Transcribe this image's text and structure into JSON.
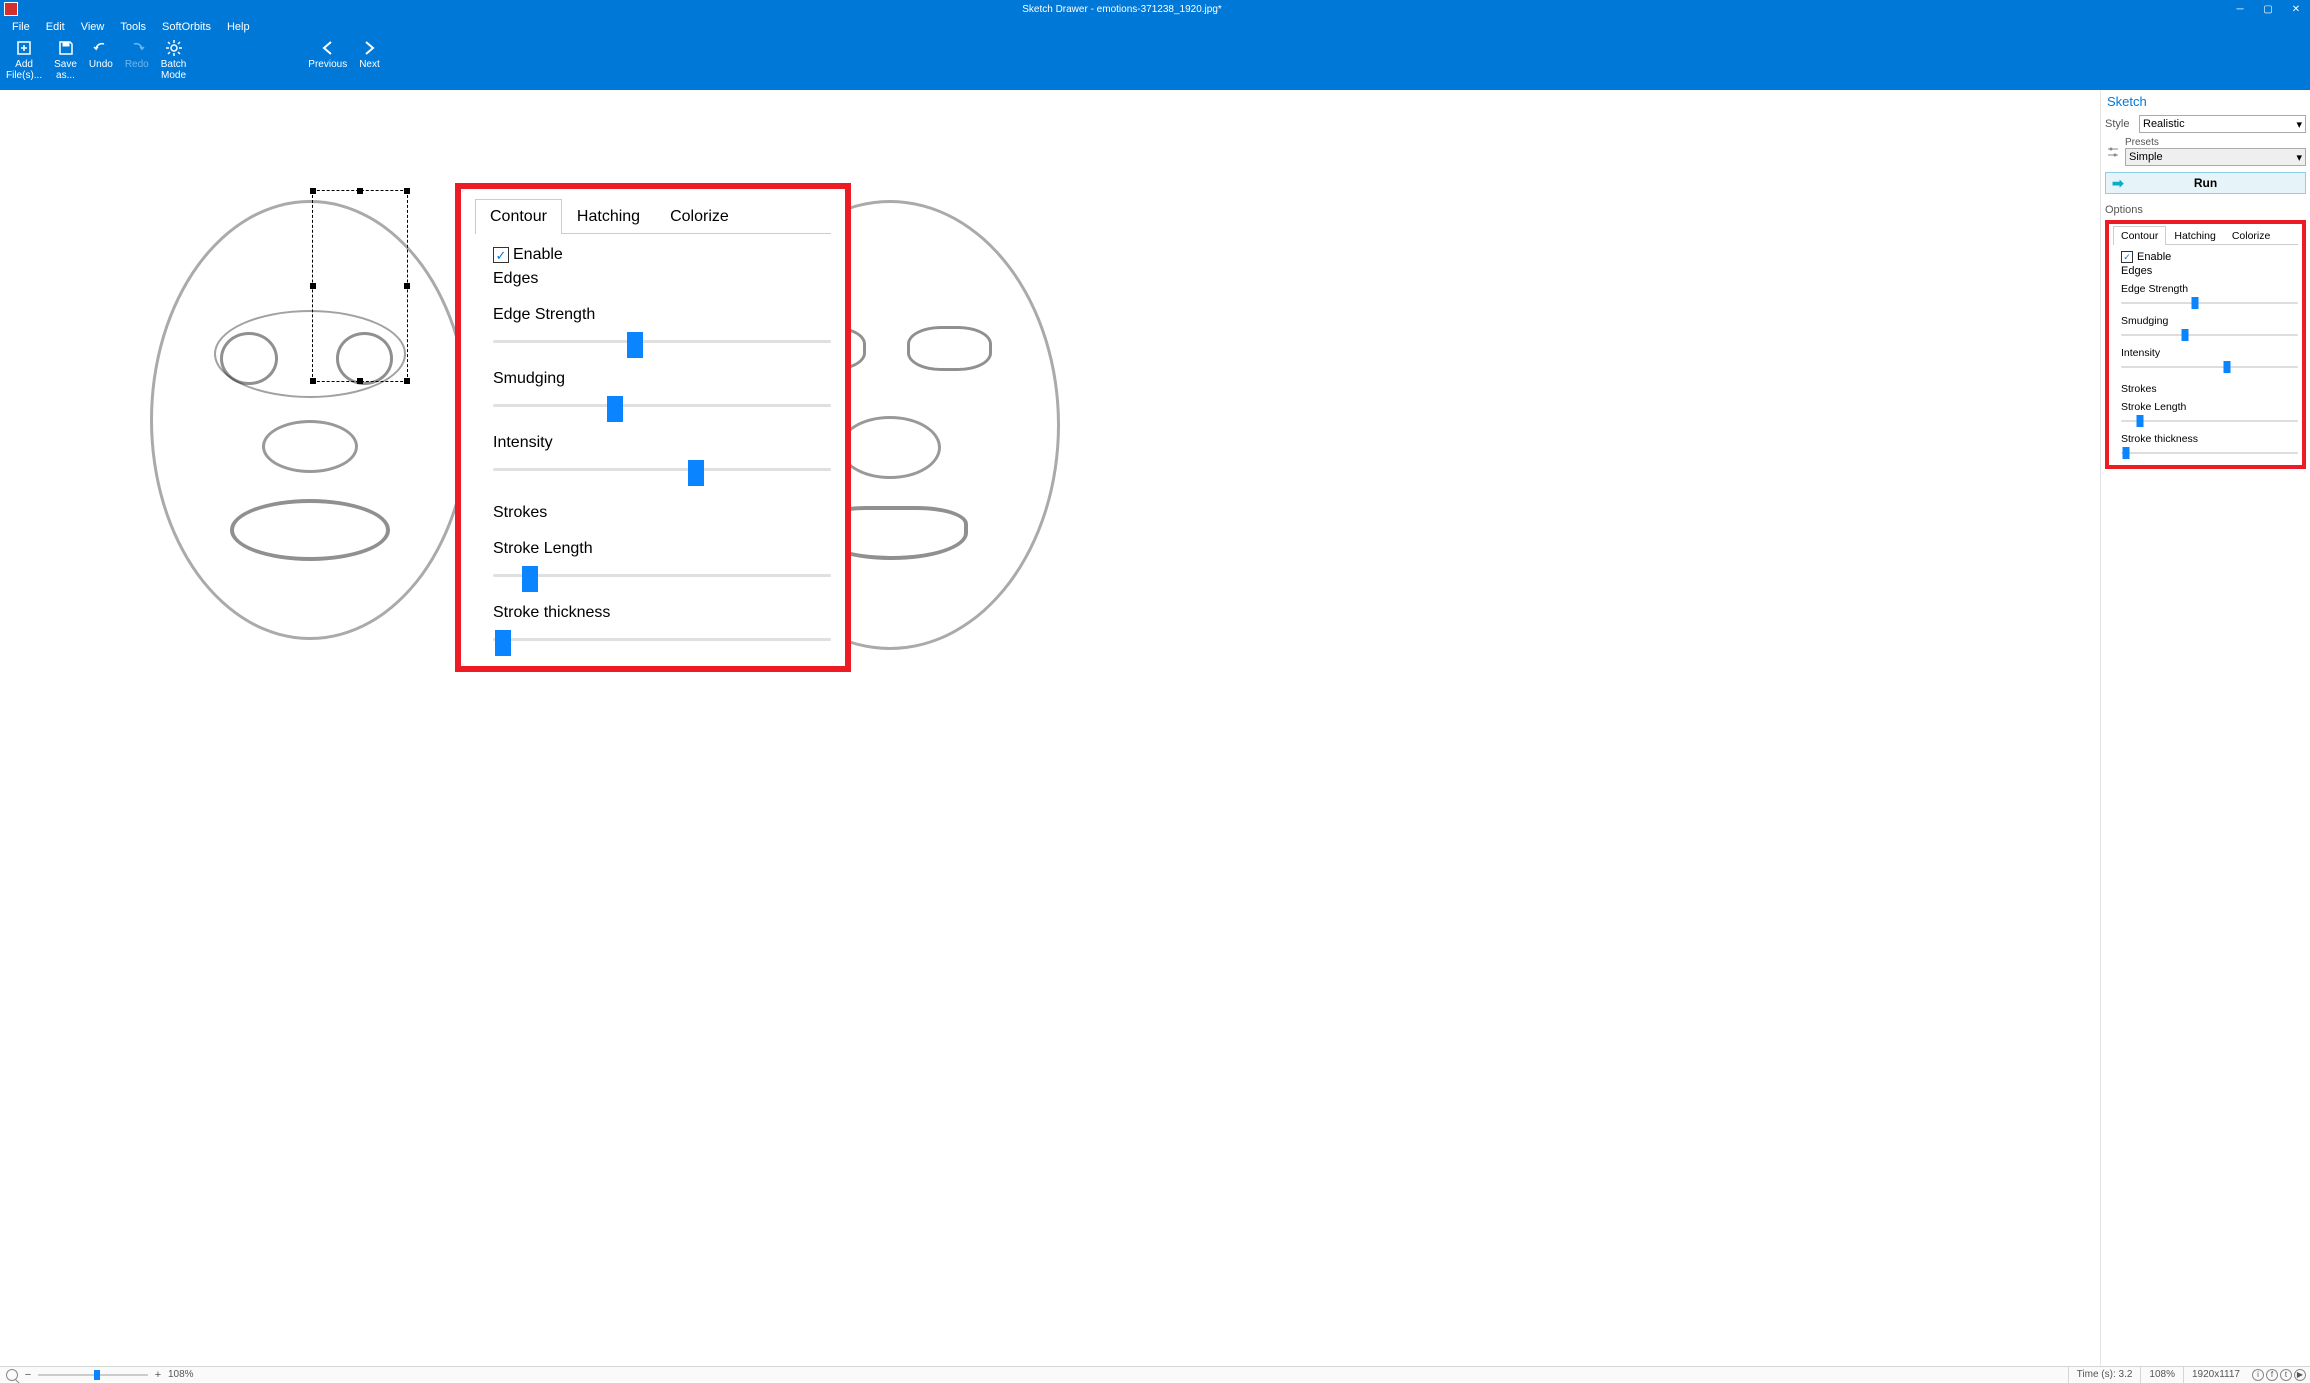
{
  "titlebar": {
    "title": "Sketch Drawer - emotions-371238_1920.jpg*"
  },
  "menubar": {
    "items": [
      "File",
      "Edit",
      "View",
      "Tools",
      "SoftOrbits",
      "Help"
    ]
  },
  "ribbon": {
    "add_files": "Add\nFile(s)...",
    "save_as": "Save\nas...",
    "undo": "Undo",
    "redo": "Redo",
    "batch_mode": "Batch\nMode",
    "previous": "Previous",
    "next": "Next"
  },
  "side": {
    "sketch_title": "Sketch",
    "style_label": "Style",
    "style_value": "Realistic",
    "presets_label": "Presets",
    "presets_value": "Simple",
    "run_label": "Run",
    "options_title": "Options",
    "tabs": {
      "contour": "Contour",
      "hatching": "Hatching",
      "colorize": "Colorize"
    },
    "enable_label": "Enable",
    "edges_label": "Edges",
    "edge_strength_label": "Edge Strength",
    "smudging_label": "Smudging",
    "intensity_label": "Intensity",
    "strokes_label": "Strokes",
    "stroke_length_label": "Stroke Length",
    "stroke_thickness_label": "Stroke thickness",
    "sliders": {
      "edge_strength_pct": 42,
      "smudging_pct": 36,
      "intensity_pct": 60,
      "stroke_length_pct": 11,
      "stroke_thickness_pct": 3
    }
  },
  "callout": {
    "tabs": {
      "contour": "Contour",
      "hatching": "Hatching",
      "colorize": "Colorize"
    },
    "enable_label": "Enable",
    "edges_label": "Edges",
    "edge_strength_label": "Edge Strength",
    "smudging_label": "Smudging",
    "intensity_label": "Intensity",
    "strokes_label": "Strokes",
    "stroke_length_label": "Stroke Length",
    "stroke_thickness_label": "Stroke thickness",
    "sliders": {
      "edge_strength_pct": 42,
      "smudging_pct": 36,
      "intensity_pct": 60,
      "stroke_length_pct": 11,
      "stroke_thickness_pct": 3
    }
  },
  "statusbar": {
    "zoom_pct_label": "108%",
    "zoom_slider_pct": 54,
    "time_label": "Time (s): 3.2",
    "zoom_right_label": "108%",
    "dimensions_label": "1920x1117"
  }
}
